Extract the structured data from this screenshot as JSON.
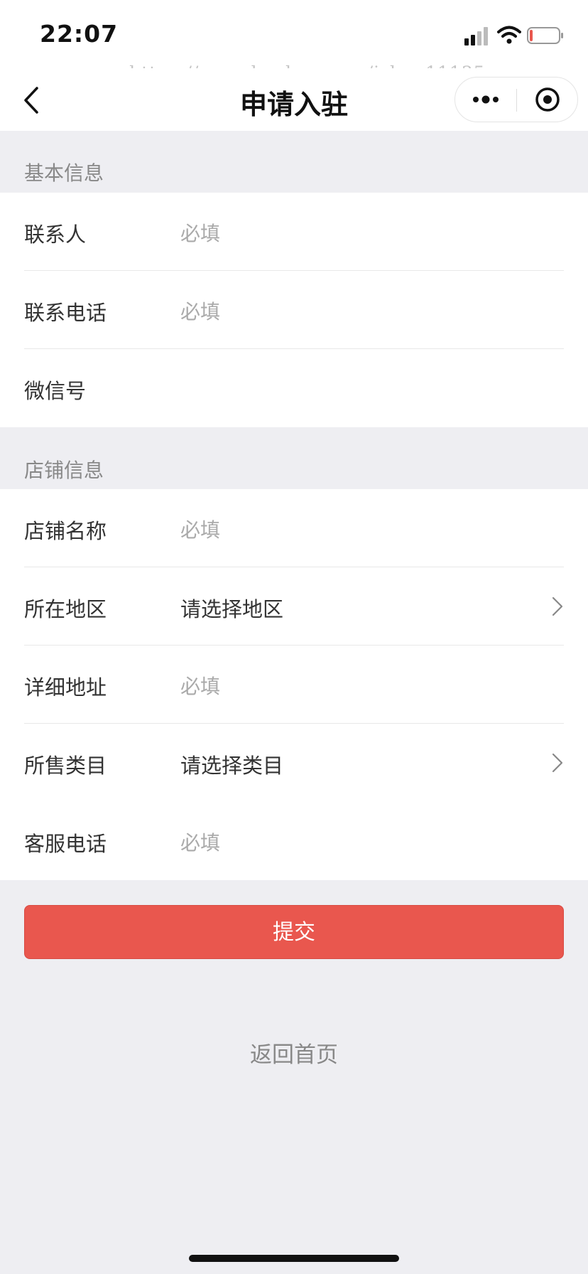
{
  "status": {
    "time": "22:07"
  },
  "watermark": "https://www.huzhan.com/ishop11135",
  "nav": {
    "title": "申请入驻"
  },
  "sections": {
    "basic": {
      "header": "基本信息",
      "rows": [
        {
          "label": "联系人",
          "placeholder": "必填"
        },
        {
          "label": "联系电话",
          "placeholder": "必填"
        },
        {
          "label": "微信号",
          "placeholder": ""
        }
      ]
    },
    "shop": {
      "header": "店铺信息",
      "rows": [
        {
          "label": "店铺名称",
          "placeholder": "必填"
        },
        {
          "label": "所在地区",
          "value": "请选择地区"
        },
        {
          "label": "详细地址",
          "placeholder": "必填"
        },
        {
          "label": "所售类目",
          "value": "请选择类目"
        },
        {
          "label": "客服电话",
          "placeholder": "必填"
        }
      ]
    }
  },
  "actions": {
    "submit": "提交",
    "home": "返回首页"
  },
  "colors": {
    "accent": "#e9574e",
    "background": "#eeeef2"
  }
}
